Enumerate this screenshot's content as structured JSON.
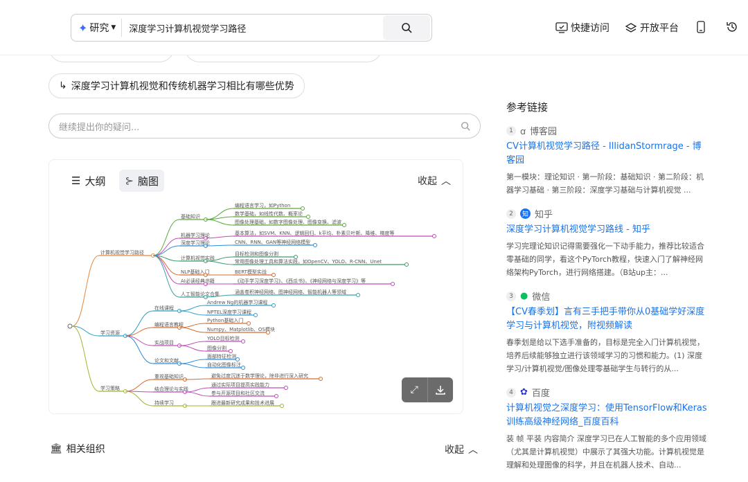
{
  "search": {
    "mode": "研究",
    "query": "深度学习计算机视觉学习路径"
  },
  "nav": {
    "quick": "快捷访问",
    "open": "开放平台"
  },
  "followup": {
    "chip": "深度学习计算机视觉和传统机器学习相比有哪些优势",
    "placeholder": "继续提出你的疑问..."
  },
  "mindmap_card": {
    "tab_outline": "大纲",
    "tab_mindmap": "脑图",
    "collapse": "收起",
    "root_branches": [
      "计算机视觉学习路径",
      "学习资源",
      "学习策略"
    ],
    "b1": [
      "基础知识",
      "机器学习理论",
      "深度学习理论",
      "计算机视觉实践",
      "NLP基础入门",
      "AI必读经典书籍",
      "人工智能论文合集"
    ],
    "b1_leaves": [
      "编程语言学习，如Python",
      "数学基础，如线性代数、概率论",
      "图像处理基础，如数字图像处理、图像变换、滤波",
      "基本算法，如SVM、KNN、逻辑回归、k平均、朴素贝叶斯、降维、梯度等",
      "CNN、RNN、GAN等神经网络模型",
      "目标检测和图像分割",
      "常用图像处理工具和算法实践，如OpenCV、YOLO、R-CNN、Unet",
      "BERT模型实战",
      "《动手学习深度学习》、《西瓜书》、《神经网络与深度学习》等",
      "涵盖卷积神经网络、图神经网络、智能机器人等领域"
    ],
    "b2": [
      "在线课程",
      "编程语言教程",
      "实战项目",
      "论文和文献"
    ],
    "b2_leaves": [
      "Andrew Ng的机器学习课程",
      "NPTEL深度学习课程",
      "Python基础入门",
      "Numpy、Matplotlib、OS模块",
      "YOLO目标检测",
      "图像分割",
      "面部特征检测",
      "自动化图像标注"
    ],
    "b3": [
      "重视基础知识",
      "结合理论与实践",
      "持续学习"
    ],
    "b3_leaves": [
      "避免过度沉迷于数学理论，除非进行深入研究",
      "通过实际项目提高实践能力",
      "参与开源项目和社区交流",
      "跟进最新研究成果和技术进展"
    ]
  },
  "related": {
    "title": "相关组织",
    "collapse": "收起"
  },
  "refs": {
    "title": "参考链接",
    "items": [
      {
        "num": "1",
        "source": "博客园",
        "title": "CV计算机视觉学习路径 - IllidanStormrage - 博客园",
        "snippet": "第一模块：理论知识 · 第一阶段：基础知识 · 第二阶段：机器学习基础 · 第三阶段：深度学习基础与计算机视觉 ..."
      },
      {
        "num": "2",
        "source": "知乎",
        "title": "深度学习计算机视觉学习路线 - 知乎",
        "snippet": "学习完理论知识记得需要强化一下动手能力，推荐比较适合零基础的同学，看这个PyTorch教程，快速入门了解神经网络架构PyTorch，进行网络搭建。（B站up主：..."
      },
      {
        "num": "3",
        "source": "微信",
        "title": "【CV春季划】言有三手把手带你从0基础学好深度学习与计算机视觉，附视频解读",
        "snippet": "春季划是给以下选手准备的，目标是完全入门计算机视觉，培养后续能够独立进行该领域学习的习惯和能力。(1) 深度学习/计算机视觉/图像处理零基础学生与转行的从..."
      },
      {
        "num": "4",
        "source": "百度",
        "title": "计算机视觉之深度学习：使用TensorFlow和Keras训练高级神经网络_百度百科",
        "snippet": "装 帧 平装 内容简介 深度学习已在人工智能的多个应用领域（尤其是计算机视觉）中展示了其强大功能。计算机视觉是理解和处理图像的科学，并且在机器人技术、自动..."
      }
    ]
  }
}
